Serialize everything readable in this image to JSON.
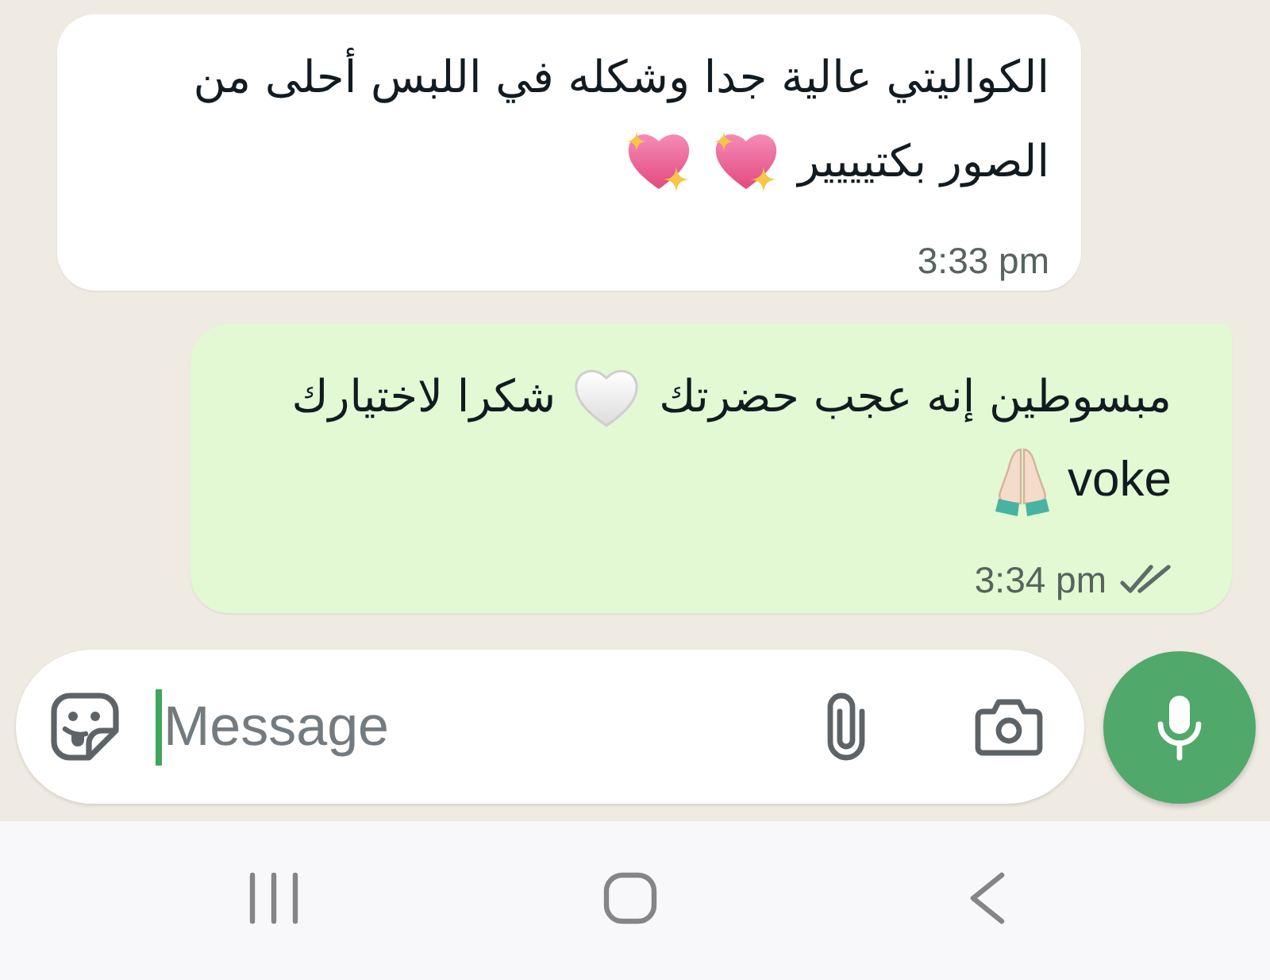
{
  "messages": [
    {
      "outgoing": false,
      "lines": [
        [
          {
            "kind": "text",
            "text": "الكواليتي عالية جدا وشكله في اللبس أحلى من"
          }
        ],
        [
          {
            "kind": "text",
            "text": "الصور بكتيييير"
          },
          {
            "kind": "sparkleheart"
          },
          {
            "kind": "sparkleheart"
          }
        ]
      ],
      "time": "3:33 pm"
    },
    {
      "outgoing": true,
      "lines": [
        [
          {
            "kind": "text",
            "text": "مبسوطين إنه عجب حضرتك"
          },
          {
            "kind": "heart"
          },
          {
            "kind": "text",
            "text": "شكرا لاختيارك"
          }
        ],
        [
          {
            "kind": "text",
            "text": "voke"
          },
          {
            "kind": "hands"
          }
        ]
      ],
      "time": "3:34 pm",
      "read": false
    }
  ],
  "composer": {
    "placeholder": "Message",
    "focused": true
  }
}
